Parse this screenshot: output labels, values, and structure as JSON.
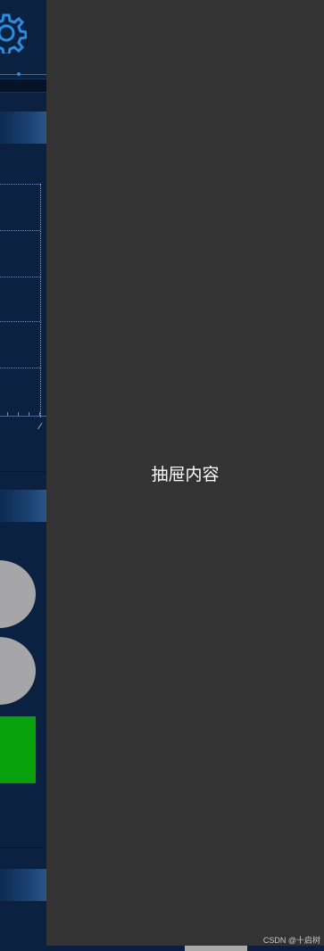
{
  "drawer": {
    "content_label": "抽屉内容"
  },
  "watermark": {
    "text": "CSDN @十启树"
  },
  "left_panel": {
    "icons": [
      "gear-icon"
    ],
    "chart_axis_mark": "⁄"
  },
  "colors": {
    "panel_bg": "#0b2142",
    "drawer_bg": "#333333",
    "accent_blue": "#2a8ee0",
    "status_green": "#08a10c",
    "indicator_gray": "#a6a6a8"
  }
}
